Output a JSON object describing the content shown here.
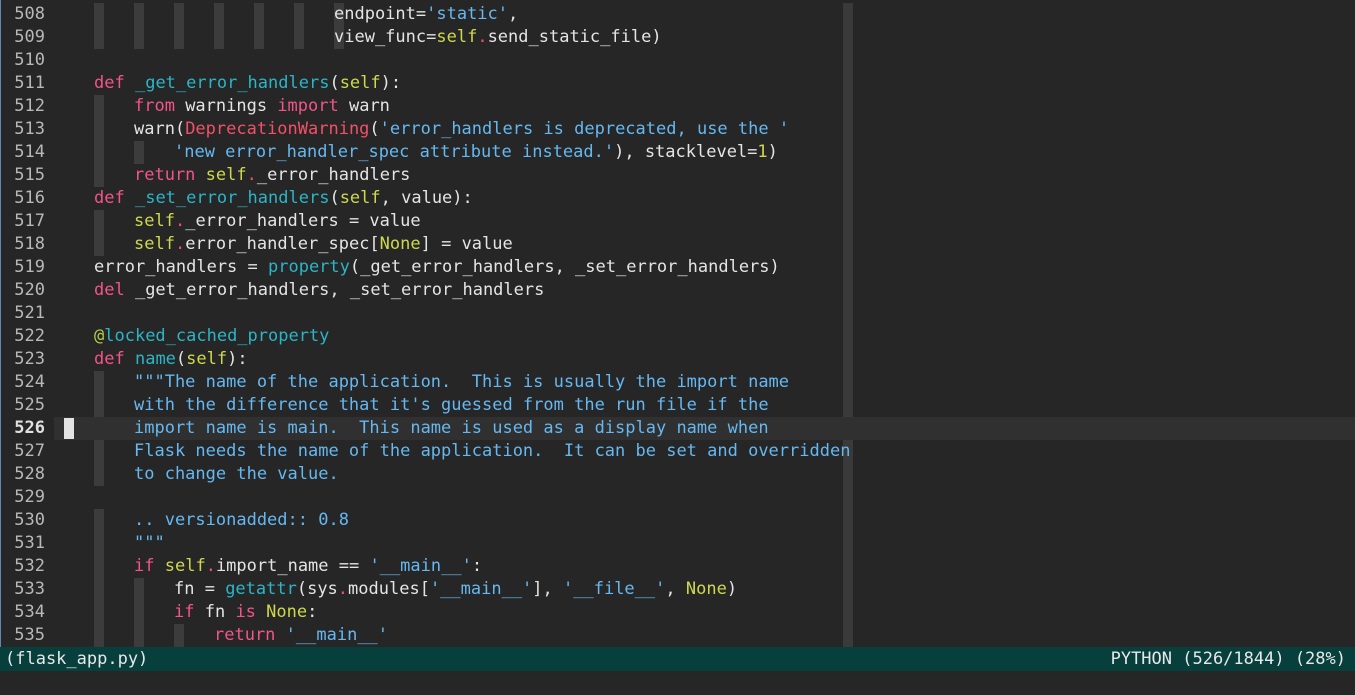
{
  "editor": {
    "first_line": 508,
    "line_numbers": [
      "508",
      "509",
      "510",
      "511",
      "512",
      "513",
      "514",
      "515",
      "516",
      "517",
      "518",
      "519",
      "520",
      "521",
      "522",
      "523",
      "524",
      "525",
      "526",
      "527",
      "528",
      "529",
      "530",
      "531",
      "532",
      "533",
      "534",
      "535"
    ],
    "current_line_number": "526",
    "colors": {
      "background": "#262626",
      "modeline_background": "#073f3d",
      "keyword": "#f2548b",
      "function_name": "#2bb5c6",
      "self": "#cfd84c",
      "string": "#65b8f1",
      "decorator": "#b5cf4a",
      "exception": "#f25068"
    },
    "lines": [
      {
        "number": "508",
        "guides": [
          1,
          2,
          3,
          4,
          5,
          6,
          7
        ],
        "indent": 7,
        "tokens": [
          [
            "",
            "endpoint="
          ],
          [
            "str",
            "'static'"
          ],
          [
            "",
            ","
          ]
        ]
      },
      {
        "number": "509",
        "guides": [
          1,
          2,
          3,
          4,
          5,
          6,
          7
        ],
        "indent": 7,
        "tokens": [
          [
            "",
            "view_func="
          ],
          [
            "sf",
            "self"
          ],
          [
            "dot",
            "."
          ],
          [
            "",
            "send_static_file)"
          ]
        ]
      },
      {
        "number": "510",
        "guides": [],
        "indent": 0,
        "tokens": []
      },
      {
        "number": "511",
        "guides": [],
        "indent": 1,
        "tokens": [
          [
            "kw",
            "def"
          ],
          [
            "",
            " "
          ],
          [
            "fn",
            "_get_error_handlers"
          ],
          [
            "",
            "("
          ],
          [
            "sf",
            "self"
          ],
          [
            "",
            "):"
          ]
        ]
      },
      {
        "number": "512",
        "guides": [
          1
        ],
        "indent": 2,
        "tokens": [
          [
            "kw",
            "from"
          ],
          [
            "",
            " warnings "
          ],
          [
            "kw",
            "import"
          ],
          [
            "",
            " warn"
          ]
        ]
      },
      {
        "number": "513",
        "guides": [
          1
        ],
        "indent": 2,
        "tokens": [
          [
            "",
            "warn("
          ],
          [
            "exc",
            "DeprecationWarning"
          ],
          [
            "",
            "("
          ],
          [
            "str",
            "'error_handlers is deprecated, use the '"
          ]
        ]
      },
      {
        "number": "514",
        "guides": [
          1,
          2
        ],
        "indent": 3,
        "tokens": [
          [
            "str",
            "'new error_handler_spec attribute instead.'"
          ],
          [
            "",
            "), stacklevel="
          ],
          [
            "num",
            "1"
          ],
          [
            "",
            ")"
          ]
        ]
      },
      {
        "number": "515",
        "guides": [
          1
        ],
        "indent": 2,
        "tokens": [
          [
            "kw",
            "return"
          ],
          [
            "",
            " "
          ],
          [
            "sf",
            "self"
          ],
          [
            "dot",
            "."
          ],
          [
            "",
            "_error_handlers"
          ]
        ]
      },
      {
        "number": "516",
        "guides": [],
        "indent": 1,
        "tokens": [
          [
            "kw",
            "def"
          ],
          [
            "",
            " "
          ],
          [
            "fn",
            "_set_error_handlers"
          ],
          [
            "",
            "("
          ],
          [
            "sf",
            "self"
          ],
          [
            "",
            ", value):"
          ]
        ]
      },
      {
        "number": "517",
        "guides": [
          1
        ],
        "indent": 2,
        "tokens": [
          [
            "sf",
            "self"
          ],
          [
            "dot",
            "."
          ],
          [
            "",
            "_error_handlers = value"
          ]
        ]
      },
      {
        "number": "518",
        "guides": [
          1
        ],
        "indent": 2,
        "tokens": [
          [
            "sf",
            "self"
          ],
          [
            "dot",
            "."
          ],
          [
            "",
            "error_handler_spec["
          ],
          [
            "nb",
            "None"
          ],
          [
            "",
            "] = value"
          ]
        ]
      },
      {
        "number": "519",
        "guides": [],
        "indent": 1,
        "tokens": [
          [
            "",
            "error_handlers = "
          ],
          [
            "bi",
            "property"
          ],
          [
            "",
            "(_get_error_handlers, _set_error_handlers)"
          ]
        ]
      },
      {
        "number": "520",
        "guides": [],
        "indent": 1,
        "tokens": [
          [
            "kw",
            "del"
          ],
          [
            "",
            " _get_error_handlers, _set_error_handlers"
          ]
        ]
      },
      {
        "number": "521",
        "guides": [],
        "indent": 0,
        "tokens": []
      },
      {
        "number": "522",
        "guides": [],
        "indent": 1,
        "tokens": [
          [
            "dec",
            "@"
          ],
          [
            "fn",
            "locked_cached_property"
          ]
        ]
      },
      {
        "number": "523",
        "guides": [],
        "indent": 1,
        "tokens": [
          [
            "kw",
            "def"
          ],
          [
            "",
            " "
          ],
          [
            "fn",
            "name"
          ],
          [
            "",
            "("
          ],
          [
            "sf",
            "self"
          ],
          [
            "",
            "):"
          ]
        ]
      },
      {
        "number": "524",
        "guides": [
          1
        ],
        "indent": 2,
        "tokens": [
          [
            "doc",
            "\"\"\"The name of the application.  This is usually the import name"
          ]
        ]
      },
      {
        "number": "525",
        "guides": [
          1
        ],
        "indent": 2,
        "tokens": [
          [
            "doc",
            "with the difference that it's guessed from the run file if the"
          ]
        ]
      },
      {
        "number": "526",
        "guides": [],
        "indent": 2,
        "current": true,
        "tokens": [
          [
            "doc",
            "import name is main.  This name is used as a display name when"
          ]
        ]
      },
      {
        "number": "527",
        "guides": [
          1
        ],
        "indent": 2,
        "tokens": [
          [
            "doc",
            "Flask needs the name of the application.  It can be set and overridden"
          ]
        ]
      },
      {
        "number": "528",
        "guides": [
          1
        ],
        "indent": 2,
        "tokens": [
          [
            "doc",
            "to change the value."
          ]
        ]
      },
      {
        "number": "529",
        "guides": [],
        "indent": 0,
        "tokens": []
      },
      {
        "number": "530",
        "guides": [
          1
        ],
        "indent": 2,
        "tokens": [
          [
            "doc",
            ".. versionadded:: 0.8"
          ]
        ]
      },
      {
        "number": "531",
        "guides": [
          1
        ],
        "indent": 2,
        "tokens": [
          [
            "doc",
            "\"\"\""
          ]
        ]
      },
      {
        "number": "532",
        "guides": [
          1
        ],
        "indent": 2,
        "tokens": [
          [
            "kw",
            "if"
          ],
          [
            "",
            " "
          ],
          [
            "sf",
            "self"
          ],
          [
            "dot",
            "."
          ],
          [
            "",
            "import_name == "
          ],
          [
            "str",
            "'__main__'"
          ],
          [
            "",
            ":"
          ]
        ]
      },
      {
        "number": "533",
        "guides": [
          1,
          2
        ],
        "indent": 3,
        "tokens": [
          [
            "",
            "fn = "
          ],
          [
            "bi",
            "getattr"
          ],
          [
            "",
            "(sys"
          ],
          [
            "dot",
            "."
          ],
          [
            "",
            "modules["
          ],
          [
            "str",
            "'__main__'"
          ],
          [
            "",
            "], "
          ],
          [
            "str",
            "'__file__'"
          ],
          [
            "",
            ", "
          ],
          [
            "nb",
            "None"
          ],
          [
            "",
            ")"
          ]
        ]
      },
      {
        "number": "534",
        "guides": [
          1,
          2
        ],
        "indent": 3,
        "tokens": [
          [
            "kw",
            "if"
          ],
          [
            "",
            " fn "
          ],
          [
            "kw",
            "is"
          ],
          [
            "",
            " "
          ],
          [
            "nb",
            "None"
          ],
          [
            "",
            ":"
          ]
        ]
      },
      {
        "number": "535",
        "guides": [
          1,
          2,
          3
        ],
        "indent": 4,
        "tokens": [
          [
            "kw",
            "return"
          ],
          [
            "",
            " "
          ],
          [
            "str",
            "'__main__'"
          ]
        ]
      }
    ]
  },
  "modeline": {
    "buffer_name": "(flask_app.py)",
    "mode_info": "PYTHON (526/1844) (28%)"
  }
}
